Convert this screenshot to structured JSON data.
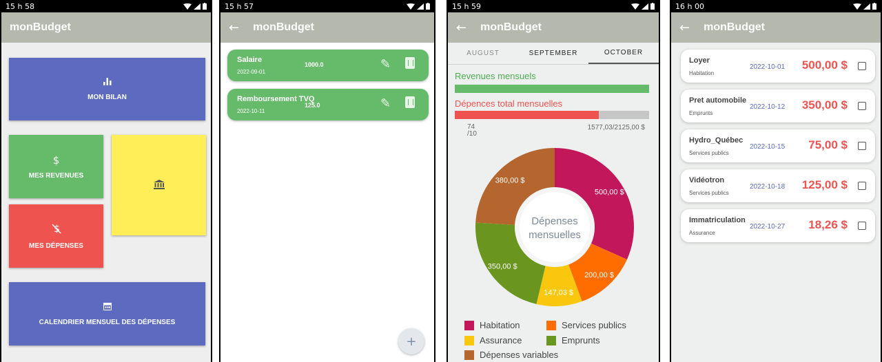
{
  "app_title": "monBudget",
  "colors": {
    "appbar": "#b5b8ad",
    "bilan": "#5c6bc0",
    "revenues": "#66bb6a",
    "depenses": "#ef5350",
    "yellow": "#ffee58",
    "calendar": "#5c6bc0",
    "amount_red": "#ef5350",
    "date_blue": "#5c6bc0"
  },
  "screen1": {
    "time": "15 h 58",
    "tiles": {
      "bilan": {
        "icon": "bar-chart-icon",
        "label": "MON BILAN"
      },
      "revenues": {
        "icon": "dollar-icon",
        "label": "MES REVENUES"
      },
      "depenses": {
        "icon": "money-off-icon",
        "label": "MES DÉPENSES"
      },
      "bank": {
        "icon": "bank-icon"
      },
      "calendar": {
        "icon": "calendar-icon",
        "label": "CALENDRIER MENSUEL DES DÉPENSES"
      }
    }
  },
  "screen2": {
    "time": "15 h 57",
    "back_icon": "back-arrow-icon",
    "revenues": [
      {
        "name": "Salaire",
        "date": "2022-09-01",
        "amount": "1000.0"
      },
      {
        "name": "Remboursement TVQ",
        "date": "2022-10-11",
        "amount": "125.0"
      }
    ],
    "edit_icon": "edit-icon",
    "delete_icon": "delete-icon",
    "fab_label": "+"
  },
  "screen3": {
    "time": "15 h 59",
    "tabs": [
      "AUGUST",
      "SEPTEMBER",
      "OCTOBER"
    ],
    "active_tab": "OCTOBER",
    "revenues_label": "Revenues mensuels",
    "revenues_fraction": 1.0,
    "depenses_label": "Dépences total mensuelles",
    "depenses_fraction": 0.742,
    "percent_label": "74",
    "percent_sub": "/10",
    "totals": "1577,03/2125,00 $",
    "donut_center": [
      "Dépenses",
      "mensuelles"
    ]
  },
  "chart_data": {
    "type": "pie",
    "title": "Dépenses mensuelles",
    "series": [
      {
        "name": "Habitation",
        "value": 500.0,
        "label": "500,00 $",
        "color": "#c2185b"
      },
      {
        "name": "Services publics",
        "value": 200.0,
        "label": "200,00 $",
        "color": "#ff6d00"
      },
      {
        "name": "Assurance",
        "value": 147.03,
        "label": "147,03 $",
        "color": "#f9c80e"
      },
      {
        "name": "Emprunts",
        "value": 350.0,
        "label": "350,00 $",
        "color": "#6a961f"
      },
      {
        "name": "Dépenses variables",
        "value": 380.0,
        "label": "380,00 $",
        "color": "#b5652e"
      }
    ],
    "legend": "bottom"
  },
  "screen4": {
    "time": "16 h 00",
    "expenses": [
      {
        "name": "Loyer",
        "category": "Habitation",
        "date": "2022-10-01",
        "amount": "500,00 $"
      },
      {
        "name": "Pret automobile",
        "category": "Emprunts",
        "date": "2022-10-12",
        "amount": "350,00 $"
      },
      {
        "name": "Hydro_Québec",
        "category": "Services publics",
        "date": "2022-10-15",
        "amount": "75,00 $"
      },
      {
        "name": "Vidéotron",
        "category": "Services publics",
        "date": "2022-10-18",
        "amount": "125,00 $"
      },
      {
        "name": "Immatriculation",
        "category": "Assurance",
        "date": "2022-10-27",
        "amount": "18,26 $"
      }
    ]
  }
}
